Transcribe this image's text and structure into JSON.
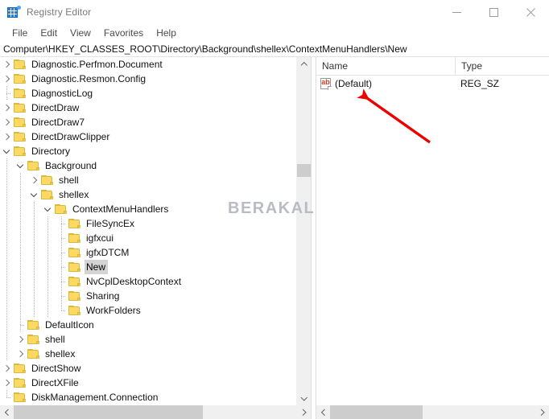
{
  "window": {
    "title": "Registry Editor",
    "icon": "registry-icon",
    "minimize_label": "—",
    "maximize_label": "☐",
    "close_label": "✕"
  },
  "menubar": {
    "items": [
      {
        "label": "File"
      },
      {
        "label": "Edit"
      },
      {
        "label": "View"
      },
      {
        "label": "Favorites"
      },
      {
        "label": "Help"
      }
    ]
  },
  "address": {
    "path": "Computer\\HKEY_CLASSES_ROOT\\Directory\\Background\\shellex\\ContextMenuHandlers\\New"
  },
  "tree": {
    "rows": [
      {
        "label": "Diagnostic.Perfmon.Document",
        "indent": 1,
        "expander": "collapsed",
        "selected": false
      },
      {
        "label": "Diagnostic.Resmon.Config",
        "indent": 1,
        "expander": "collapsed",
        "selected": false
      },
      {
        "label": "DiagnosticLog",
        "indent": 1,
        "expander": "none",
        "selected": false
      },
      {
        "label": "DirectDraw",
        "indent": 1,
        "expander": "collapsed",
        "selected": false
      },
      {
        "label": "DirectDraw7",
        "indent": 1,
        "expander": "collapsed",
        "selected": false
      },
      {
        "label": "DirectDrawClipper",
        "indent": 1,
        "expander": "collapsed",
        "selected": false
      },
      {
        "label": "Directory",
        "indent": 1,
        "expander": "expanded",
        "selected": false
      },
      {
        "label": "Background",
        "indent": 2,
        "expander": "expanded",
        "selected": false
      },
      {
        "label": "shell",
        "indent": 3,
        "expander": "collapsed",
        "selected": false
      },
      {
        "label": "shellex",
        "indent": 3,
        "expander": "expanded",
        "selected": false
      },
      {
        "label": "ContextMenuHandlers",
        "indent": 4,
        "expander": "expanded",
        "selected": false
      },
      {
        "label": "FileSyncEx",
        "indent": 5,
        "expander": "none",
        "selected": false
      },
      {
        "label": "igfxcui",
        "indent": 5,
        "expander": "none",
        "selected": false
      },
      {
        "label": "igfxDTCM",
        "indent": 5,
        "expander": "none",
        "selected": false
      },
      {
        "label": "New",
        "indent": 5,
        "expander": "none",
        "selected": true
      },
      {
        "label": "NvCplDesktopContext",
        "indent": 5,
        "expander": "none",
        "selected": false
      },
      {
        "label": "Sharing",
        "indent": 5,
        "expander": "none",
        "selected": false
      },
      {
        "label": "WorkFolders",
        "indent": 5,
        "expander": "none",
        "selected": false
      },
      {
        "label": "DefaultIcon",
        "indent": 2,
        "expander": "none",
        "selected": false
      },
      {
        "label": "shell",
        "indent": 2,
        "expander": "collapsed",
        "selected": false
      },
      {
        "label": "shellex",
        "indent": 2,
        "expander": "collapsed",
        "selected": false
      },
      {
        "label": "DirectShow",
        "indent": 1,
        "expander": "collapsed",
        "selected": false
      },
      {
        "label": "DirectXFile",
        "indent": 1,
        "expander": "collapsed",
        "selected": false
      },
      {
        "label": "DiskManagement.Connection",
        "indent": 1,
        "expander": "none",
        "selected": false
      }
    ]
  },
  "list": {
    "columns": [
      {
        "label": "Name"
      },
      {
        "label": "Type"
      }
    ],
    "rows": [
      {
        "icon": "string-value-icon",
        "icon_text": "ab",
        "name": "(Default)",
        "type": "REG_SZ"
      }
    ]
  },
  "watermark": {
    "text": "BERAKAL"
  },
  "annotation": {
    "arrow_color": "#ee0000",
    "arrow_target": "(Default)"
  }
}
